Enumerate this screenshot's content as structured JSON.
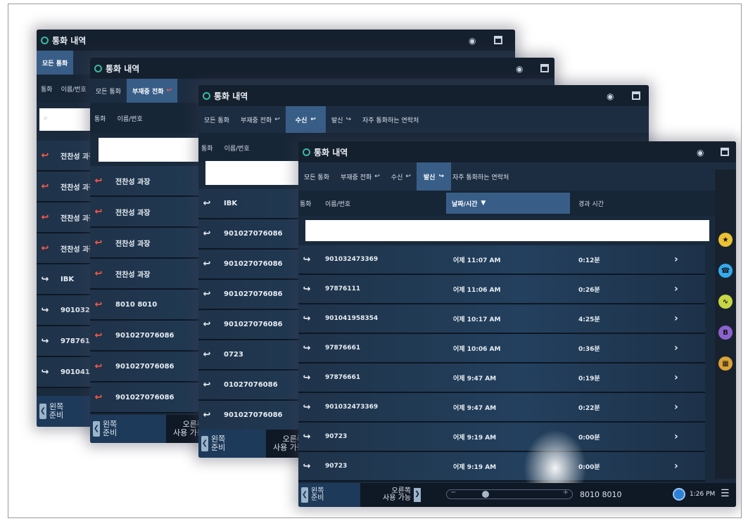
{
  "app_title": "통화 내역",
  "tabs": {
    "all": "모든 통화",
    "missed": "부재중 전화",
    "received": "수신",
    "dialed": "발신",
    "frequent": "자주 통화하는 연락처"
  },
  "columns": {
    "call": "통화",
    "name_number": "이름/번호",
    "datetime": "날짜/시간",
    "duration": "경과 시간"
  },
  "bottom": {
    "left_line1": "왼쪽",
    "left_line2": "준비",
    "right_line1": "오른쪽",
    "right_line2": "사용 가능",
    "phone_number": "8010 8010",
    "clock": "1:26 PM"
  },
  "screen1": {
    "rows": [
      {
        "icon": "missed-call-icon",
        "name": "전찬성 과장"
      },
      {
        "icon": "missed-call-icon",
        "name": "전찬성 과장"
      },
      {
        "icon": "missed-call-icon",
        "name": "전찬성 과장"
      },
      {
        "icon": "missed-call-icon",
        "name": "전찬성 과장"
      },
      {
        "icon": "outgoing-call-icon",
        "name": "IBK"
      },
      {
        "icon": "outgoing-call-icon",
        "name": "901032473369"
      },
      {
        "icon": "outgoing-call-icon",
        "name": "97876111"
      },
      {
        "icon": "outgoing-call-icon",
        "name": "901041958354"
      }
    ]
  },
  "screen2": {
    "rows": [
      {
        "name": "전찬성 과장"
      },
      {
        "name": "전찬성 과장"
      },
      {
        "name": "전찬성 과장"
      },
      {
        "name": "전찬성 과장"
      },
      {
        "name": "8010 8010"
      },
      {
        "name": "901027076086"
      },
      {
        "name": "901027076086"
      },
      {
        "name": "901027076086"
      }
    ]
  },
  "screen3": {
    "rows": [
      {
        "name": "IBK"
      },
      {
        "name": "901027076086"
      },
      {
        "name": "901027076086"
      },
      {
        "name": "901027076086"
      },
      {
        "name": "901027076086"
      },
      {
        "name": "0723"
      },
      {
        "name": "01027076086"
      },
      {
        "name": "901027076086"
      }
    ]
  },
  "screen4": {
    "rows": [
      {
        "name": "901032473369",
        "datetime": "어제 11:07 AM",
        "duration": "0:12분"
      },
      {
        "name": "97876111",
        "datetime": "어제 11:06 AM",
        "duration": "0:26분"
      },
      {
        "name": "901041958354",
        "datetime": "어제 10:17 AM",
        "duration": "4:25분"
      },
      {
        "name": "97876661",
        "datetime": "어제 10:06 AM",
        "duration": "0:36분"
      },
      {
        "name": "97876661",
        "datetime": "어제 9:47 AM",
        "duration": "0:19분"
      },
      {
        "name": "901032473369",
        "datetime": "어제 9:47 AM",
        "duration": "0:22분"
      },
      {
        "name": "90723",
        "datetime": "어제 9:19 AM",
        "duration": "0:00분"
      },
      {
        "name": "90723",
        "datetime": "어제 9:19 AM",
        "duration": "0:00분"
      }
    ]
  },
  "side_icons": [
    {
      "icon": "star-icon",
      "color": "#e8c23a"
    },
    {
      "icon": "phone-app-icon",
      "color": "#39a9e8"
    },
    {
      "icon": "activity-icon",
      "color": "#c7d64a"
    },
    {
      "icon": "b-app-icon",
      "color": "#8a63c9"
    },
    {
      "icon": "grid-app-icon",
      "color": "#d9a23b"
    }
  ]
}
